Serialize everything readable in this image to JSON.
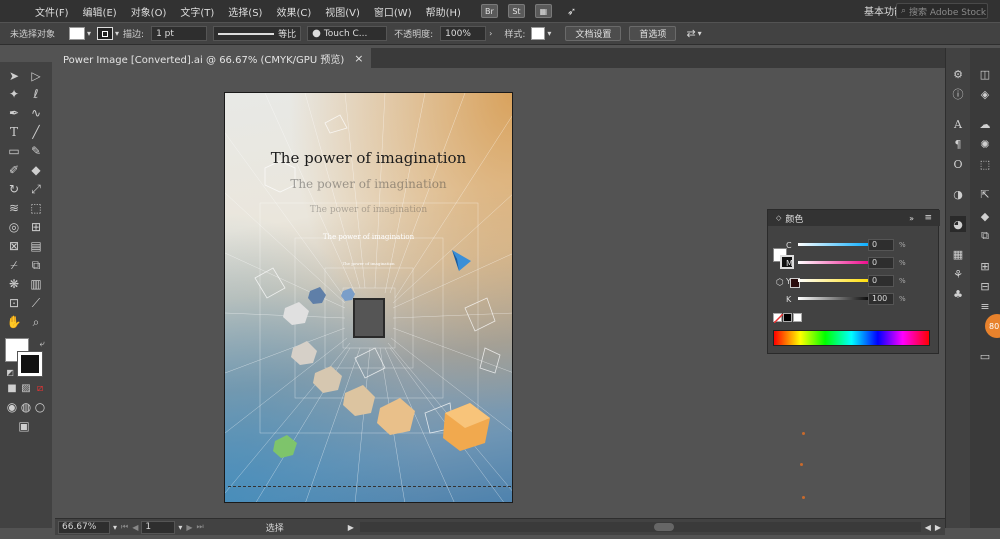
{
  "menubar": {
    "items": [
      "文件(F)",
      "编辑(E)",
      "对象(O)",
      "文字(T)",
      "选择(S)",
      "效果(C)",
      "视图(V)",
      "窗口(W)",
      "帮助(H)"
    ],
    "bridge": "Br",
    "stock": "St",
    "workspace": "基本功能",
    "search_placeholder": "搜索 Adobe Stock"
  },
  "controlbar": {
    "selection": "未选择对象",
    "stroke_label": "描边:",
    "stroke_weight": "1 pt",
    "profile": "等比",
    "brush": "Touch C...",
    "opacity_label": "不透明度:",
    "opacity": "100%",
    "style_label": "样式:",
    "doc_setup": "文档设置",
    "preferences": "首选项"
  },
  "document": {
    "tab_title": "Power Image [Converted].ai @ 66.67% (CMYK/GPU 预览)",
    "close": "×"
  },
  "artboard": {
    "titles": [
      "The power of imagination",
      "The power of imagination",
      "The power of imagination",
      "The power of imagination",
      "The power of imagination"
    ]
  },
  "color_panel": {
    "title": "颜色",
    "channels": [
      {
        "label": "C",
        "value": "0",
        "unit": "%"
      },
      {
        "label": "M",
        "value": "0",
        "unit": "%"
      },
      {
        "label": "Y",
        "value": "0",
        "unit": "%"
      },
      {
        "label": "K",
        "value": "100",
        "unit": "%"
      }
    ]
  },
  "statusbar": {
    "zoom": "66.67%",
    "page": "1",
    "tool": "选择"
  },
  "badge": "80",
  "colors": {
    "menubar": "#323232",
    "panel": "#424242",
    "canvas": "#535353",
    "accent_orange": "#e8822c"
  }
}
